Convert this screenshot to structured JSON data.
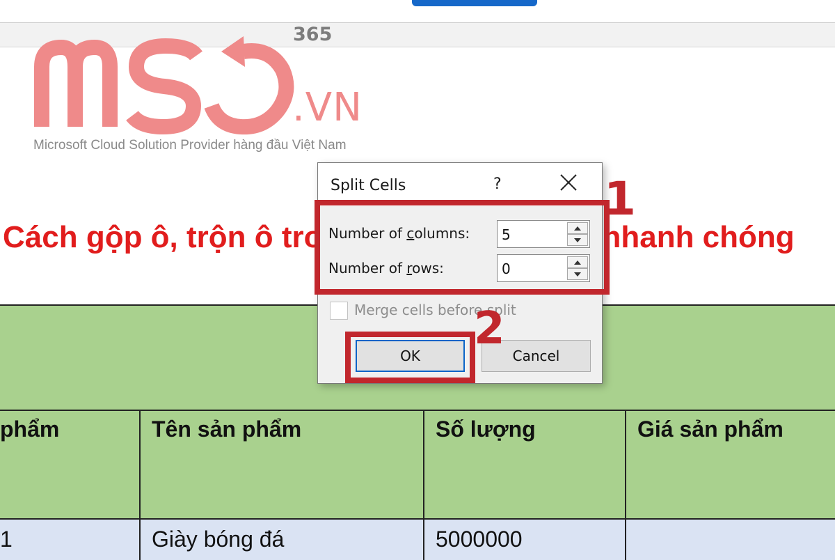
{
  "branding": {
    "product": "365",
    "domain": ".VN",
    "tagline": "Microsoft Cloud Solution Provider hàng đầu Việt Nam",
    "logo_text": "MSO",
    "brand_color": "#ef8a8a"
  },
  "document": {
    "heading": "Cách gộp ô, trộn ô trong Word đơn giản, nhanh chóng",
    "heading_color": "#e11d1d",
    "table": {
      "header_bg": "#a9d18e",
      "row_bg": "#dae3f3",
      "headers": [
        "phẩm",
        "Tên sản phẩm",
        "Số lượng",
        "Giá sản phẩm"
      ],
      "rows": [
        [
          "1",
          "Giày bóng đá",
          "5000000",
          ""
        ]
      ]
    }
  },
  "dialog": {
    "title": "Split Cells",
    "help_label": "?",
    "close_icon": "close-icon",
    "columns_label": {
      "pre": "Number of ",
      "key": "c",
      "post": "olumns:"
    },
    "columns_value": "5",
    "rows_label": {
      "pre": "Number of ",
      "key": "r",
      "post": "ows:"
    },
    "rows_value": "0",
    "merge_label": "Merge cells before split",
    "merge_checked": false,
    "ok_label": "OK",
    "cancel_label": "Cancel"
  },
  "annotations": {
    "step1": "1",
    "step2": "2",
    "highlight_color": "#c1272d"
  }
}
